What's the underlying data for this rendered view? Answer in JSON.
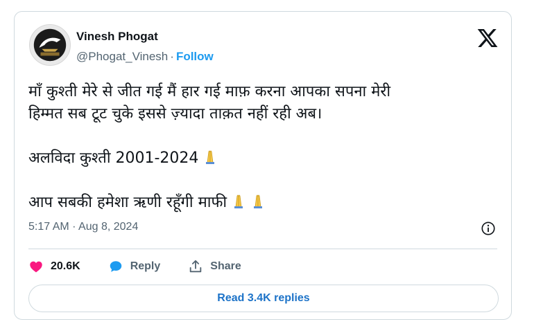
{
  "user": {
    "name": "Vinesh Phogat",
    "handle": "@Phogat_Vinesh",
    "separator": "·",
    "follow_label": "Follow"
  },
  "tweet": {
    "lines": [
      "माँ कुश्ती मेरे से जीत गई मैं हार गई माफ़ करना आपका सपना मेरी",
      "हिम्मत सब टूट चुके इससे ज़्यादा ताक़त नहीं रही अब।",
      "अलविदा कुश्ती 2001-2024",
      "आप सबकी हमेशा ऋणी रहूँगी माफी"
    ],
    "emoji": [
      "folded-hands",
      "folded-hands",
      "folded-hands"
    ]
  },
  "meta": {
    "time": "5:17 AM",
    "separator": "·",
    "date": "Aug 8, 2024"
  },
  "actions": {
    "likes": "20.6K",
    "reply_label": "Reply",
    "share_label": "Share"
  },
  "read_replies_label": "Read 3.4K replies",
  "colors": {
    "like": "#f91880",
    "reply": "#1d9bf0",
    "link": "#1d9bf0",
    "border": "#cfd9de",
    "secondary_text": "#536471"
  }
}
